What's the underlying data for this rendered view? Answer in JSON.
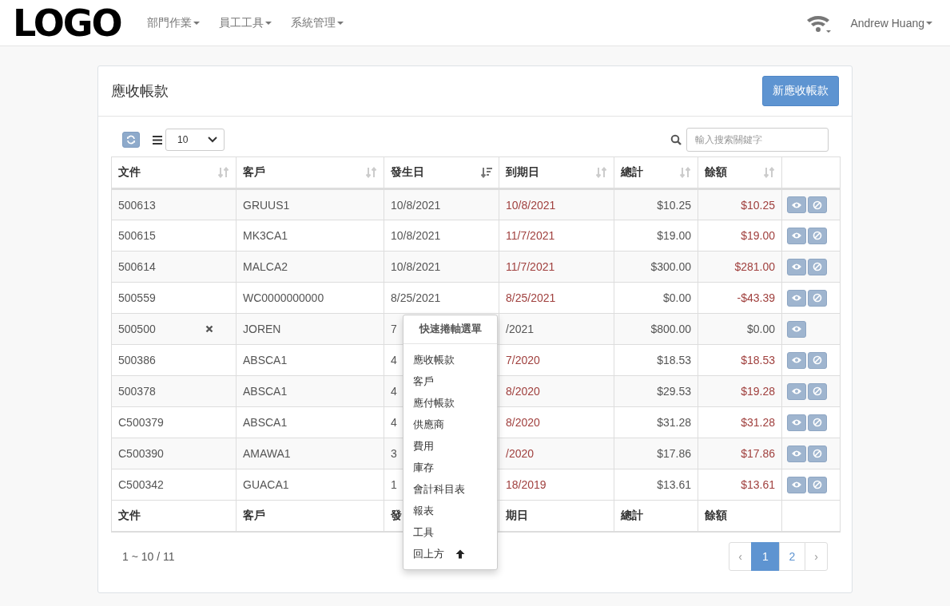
{
  "navbar": {
    "logo": "LOGO",
    "menus": [
      {
        "label": "部門作業"
      },
      {
        "label": "員工工具"
      },
      {
        "label": "系統管理"
      }
    ],
    "user": "Andrew Huang"
  },
  "panel": {
    "title": "應收帳款",
    "new_button": "新應收帳款"
  },
  "toolbar": {
    "page_size": "10",
    "search_placeholder": "輸入搜索關鍵字"
  },
  "table": {
    "columns": [
      {
        "label": "文件",
        "sorted": false
      },
      {
        "label": "客戶",
        "sorted": false
      },
      {
        "label": "發生日",
        "sorted": true
      },
      {
        "label": "到期日",
        "sorted": false
      },
      {
        "label": "總計",
        "sorted": false
      },
      {
        "label": "餘額",
        "sorted": false
      }
    ],
    "rows": [
      {
        "doc": "500613",
        "customer": "GRUUS1",
        "issued": "10/8/2021",
        "due": "10/8/2021",
        "total": "$10.25",
        "balance": "$10.25",
        "overdue": true,
        "voided": false
      },
      {
        "doc": "500615",
        "customer": "MK3CA1",
        "issued": "10/8/2021",
        "due": "11/7/2021",
        "total": "$19.00",
        "balance": "$19.00",
        "overdue": true,
        "voided": false
      },
      {
        "doc": "500614",
        "customer": "MALCA2",
        "issued": "10/8/2021",
        "due": "11/7/2021",
        "total": "$300.00",
        "balance": "$281.00",
        "overdue": true,
        "voided": false
      },
      {
        "doc": "500559",
        "customer": "WC0000000000",
        "issued": "8/25/2021",
        "due": "8/25/2021",
        "total": "$0.00",
        "balance": "-$43.39",
        "overdue": true,
        "voided": false
      },
      {
        "doc": "500500",
        "customer": "JOREN",
        "issued": "7",
        "due": "/2021",
        "total": "$800.00",
        "balance": "$0.00",
        "overdue": false,
        "voided": true
      },
      {
        "doc": "500386",
        "customer": "ABSCA1",
        "issued": "4",
        "due": "7/2020",
        "total": "$18.53",
        "balance": "$18.53",
        "overdue": true,
        "voided": false
      },
      {
        "doc": "500378",
        "customer": "ABSCA1",
        "issued": "4",
        "due": "8/2020",
        "total": "$29.53",
        "balance": "$19.28",
        "overdue": true,
        "voided": false
      },
      {
        "doc": "C500379",
        "customer": "ABSCA1",
        "issued": "4",
        "due": "8/2020",
        "total": "$31.28",
        "balance": "$31.28",
        "overdue": true,
        "voided": false
      },
      {
        "doc": "C500390",
        "customer": "AMAWA1",
        "issued": "3",
        "due": "/2020",
        "total": "$17.86",
        "balance": "$17.86",
        "overdue": true,
        "voided": false
      },
      {
        "doc": "C500342",
        "customer": "GUACA1",
        "issued": "1",
        "due": "18/2019",
        "total": "$13.61",
        "balance": "$13.61",
        "overdue": true,
        "voided": false
      }
    ],
    "footer": [
      "文件",
      "客戶",
      "發",
      "期日",
      "總計",
      "餘額"
    ]
  },
  "summary": "1 ~ 10 / 11",
  "pagination": [
    {
      "label": "‹",
      "selected": false
    },
    {
      "label": "1",
      "selected": true
    },
    {
      "label": "2",
      "selected": false
    },
    {
      "label": "›",
      "selected": false
    }
  ],
  "quick_menu": {
    "title": "快速捲軸選單",
    "items": [
      {
        "label": "應收帳款",
        "kind": "link"
      },
      {
        "label": "客戶",
        "kind": "link"
      },
      {
        "label": "應付帳款",
        "kind": "link"
      },
      {
        "label": "供應商",
        "kind": "link"
      },
      {
        "label": "費用",
        "kind": "link"
      },
      {
        "label": "庫存",
        "kind": "link"
      },
      {
        "label": "會計科目表",
        "kind": "link"
      },
      {
        "label": "報表",
        "kind": "link"
      },
      {
        "label": "工具",
        "kind": "link"
      },
      {
        "label": "回上方",
        "kind": "top"
      }
    ]
  }
}
